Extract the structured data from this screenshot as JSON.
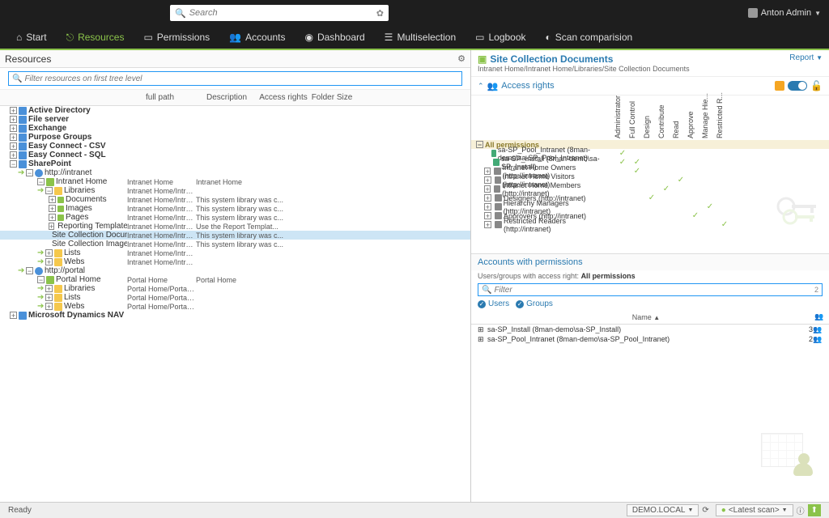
{
  "topbar": {
    "search_placeholder": "Search",
    "user_name": "Anton Admin"
  },
  "nav": {
    "items": [
      {
        "icon": "⌂",
        "label": "Start"
      },
      {
        "icon": "⎋",
        "label": "Resources",
        "active": true
      },
      {
        "icon": "▭",
        "label": "Permissions"
      },
      {
        "icon": "👥",
        "label": "Accounts"
      },
      {
        "icon": "◉",
        "label": "Dashboard"
      },
      {
        "icon": "☰",
        "label": "Multiselection"
      },
      {
        "icon": "▭",
        "label": "Logbook"
      },
      {
        "icon": "◐",
        "label": "Scan comparision"
      }
    ]
  },
  "left": {
    "title": "Resources",
    "filter_placeholder": "Filter resources on first tree level",
    "columns": {
      "path": "full path",
      "desc": "Description",
      "access": "Access rights",
      "size": "Folder Size"
    }
  },
  "tree": [
    {
      "d": 0,
      "exp": "+",
      "icon": "share",
      "label": "Active Directory",
      "bold": true
    },
    {
      "d": 0,
      "exp": "+",
      "icon": "share",
      "label": "File server",
      "bold": true
    },
    {
      "d": 0,
      "exp": "+",
      "icon": "share",
      "label": "Exchange",
      "bold": true
    },
    {
      "d": 0,
      "exp": "+",
      "icon": "share",
      "label": "Purpose Groups",
      "bold": true
    },
    {
      "d": 0,
      "exp": "+",
      "icon": "share",
      "label": "Easy Connect - CSV",
      "bold": true
    },
    {
      "d": 0,
      "exp": "+",
      "icon": "share",
      "label": "Easy Connect - SQL",
      "bold": true
    },
    {
      "d": 0,
      "exp": "−",
      "icon": "share",
      "label": "SharePoint",
      "bold": true
    },
    {
      "d": 1,
      "exp": "−",
      "icon": "web",
      "label": "http://intranet",
      "pre": "arrow"
    },
    {
      "d": 2,
      "exp": "−",
      "icon": "sp",
      "label": "Intranet Home",
      "path": "Intranet Home",
      "desc": "Intranet Home",
      "pre": "box"
    },
    {
      "d": 3,
      "exp": "−",
      "icon": "folder",
      "label": "Libraries",
      "path": "Intranet Home/Intranet Ho...",
      "pre": "arrow"
    },
    {
      "d": 4,
      "exp": "+",
      "icon": "doc",
      "label": "Documents",
      "path": "Intranet Home/Intranet Ho...",
      "desc": "This system library was c..."
    },
    {
      "d": 4,
      "exp": "+",
      "icon": "doc",
      "label": "Images",
      "path": "Intranet Home/Intranet Ho...",
      "desc": "This system library was c..."
    },
    {
      "d": 4,
      "exp": "+",
      "icon": "doc",
      "label": "Pages",
      "path": "Intranet Home/Intranet Ho...",
      "desc": "This system library was c..."
    },
    {
      "d": 4,
      "exp": "+",
      "icon": "doc",
      "label": "Reporting Templates",
      "path": "Intranet Home/Intranet Ho...",
      "desc": "Use the Report Templat..."
    },
    {
      "d": 4,
      "exp": " ",
      "icon": "doc",
      "label": "Site Collection Documents",
      "path": "Intranet Home/Intranet Ho...",
      "desc": "This system library was c...",
      "sel": true
    },
    {
      "d": 4,
      "exp": " ",
      "icon": "doc",
      "label": "Site Collection Images",
      "path": "Intranet Home/Intranet Ho...",
      "desc": "This system library was c..."
    },
    {
      "d": 3,
      "exp": "+",
      "icon": "folder",
      "label": "Lists",
      "path": "Intranet Home/Intranet Ho...",
      "pre": "arrow"
    },
    {
      "d": 3,
      "exp": "+",
      "icon": "folder",
      "label": "Webs",
      "path": "Intranet Home/Intranet Ho...",
      "pre": "arrow"
    },
    {
      "d": 1,
      "exp": "−",
      "icon": "web",
      "label": "http://portal",
      "pre": "arrow"
    },
    {
      "d": 2,
      "exp": "−",
      "icon": "sp",
      "label": "Portal Home",
      "path": "Portal Home",
      "desc": "Portal Home",
      "pre": "box"
    },
    {
      "d": 3,
      "exp": "+",
      "icon": "folder",
      "label": "Libraries",
      "path": "Portal Home/Portal Home/Li...",
      "pre": "arrow"
    },
    {
      "d": 3,
      "exp": "+",
      "icon": "folder",
      "label": "Lists",
      "path": "Portal Home/Portal Home/...",
      "pre": "arrow"
    },
    {
      "d": 3,
      "exp": "+",
      "icon": "folder",
      "label": "Webs",
      "path": "Portal Home/Portal Home/...",
      "pre": "arrow"
    },
    {
      "d": 0,
      "exp": "+",
      "icon": "share",
      "label": "Microsoft Dynamics NAV",
      "bold": true
    }
  ],
  "right": {
    "title": "Site Collection Documents",
    "path": "Intranet Home/Intranet Home/Libraries/Site Collection Documents",
    "report": "Report",
    "access_rights_title": "Access rights",
    "perm_cols": [
      "Administrator",
      "Full Control",
      "Design",
      "Contribute",
      "Read",
      "Approve",
      "Manage Hie...",
      "Restricted R..."
    ],
    "all_permissions": "All permissions",
    "principals": [
      {
        "label": "sa-SP_Pool_Intranet (8man-demo\\sa-SP_Pool_Intranet)",
        "type": "user",
        "checks": [
          1,
          0,
          0,
          0,
          0,
          0,
          0,
          0
        ]
      },
      {
        "label": "sa-SP_Install (8man-demo\\sa-SP_Install)",
        "type": "user",
        "checks": [
          1,
          1,
          0,
          0,
          0,
          0,
          0,
          0
        ]
      },
      {
        "label": "Intranet Home Owners (http://intranet)",
        "type": "group",
        "exp": "+",
        "checks": [
          0,
          1,
          0,
          0,
          0,
          0,
          0,
          0
        ]
      },
      {
        "label": "Intranet Home Visitors (http://intranet)",
        "type": "group",
        "exp": "+",
        "checks": [
          0,
          0,
          0,
          0,
          1,
          0,
          0,
          0
        ]
      },
      {
        "label": "Intranet Home Members (http://intranet)",
        "type": "group",
        "exp": "+",
        "checks": [
          0,
          0,
          0,
          1,
          0,
          0,
          0,
          0
        ]
      },
      {
        "label": "Designers (http://intranet)",
        "type": "group",
        "exp": "+",
        "checks": [
          0,
          0,
          1,
          0,
          0,
          0,
          0,
          0
        ]
      },
      {
        "label": "Hierarchy Managers (http://intranet)",
        "type": "group",
        "exp": "+",
        "checks": [
          0,
          0,
          0,
          0,
          0,
          0,
          1,
          0
        ]
      },
      {
        "label": "Approvers (http://intranet)",
        "type": "group",
        "exp": "+",
        "checks": [
          0,
          0,
          0,
          0,
          0,
          1,
          0,
          0
        ]
      },
      {
        "label": "Restricted Readers (http://intranet)",
        "type": "group",
        "exp": "+",
        "checks": [
          0,
          0,
          0,
          0,
          0,
          0,
          0,
          1
        ]
      }
    ]
  },
  "accounts": {
    "title": "Accounts with permissions",
    "sub_prefix": "Users/groups with access right:",
    "sub_value": "All permissions",
    "filter_placeholder": "Filter",
    "filter_count": "2",
    "toggle_users": "Users",
    "toggle_groups": "Groups",
    "col_name": "Name",
    "rows": [
      {
        "name": "sa-SP_Install (8man-demo\\sa-SP_Install)",
        "num": "3"
      },
      {
        "name": "sa-SP_Pool_Intranet (8man-demo\\sa-SP_Pool_Intranet)",
        "num": "2"
      }
    ]
  },
  "status": {
    "ready": "Ready",
    "domain": "DEMO.LOCAL",
    "scan": "<Latest scan>"
  }
}
